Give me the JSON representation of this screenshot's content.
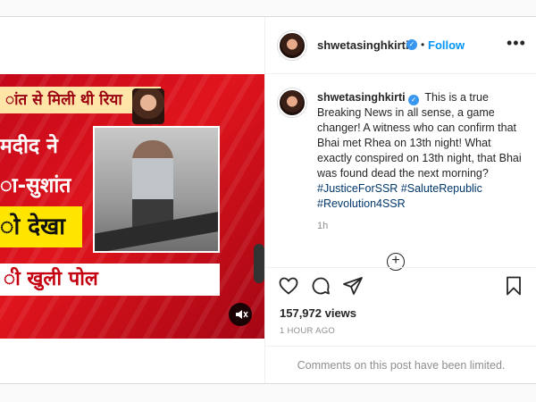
{
  "media": {
    "headline_1": "ांत से मिली थी रिया",
    "headline_2": "मदीद ने",
    "headline_3": "ा-सुशांत",
    "headline_4": "ो देखा",
    "headline_5": "ी खुली पोल",
    "mute_icon": "speaker-muted-icon"
  },
  "header": {
    "username": "shwetasinghkirti",
    "verified_icon": "verified-badge-icon",
    "separator": "•",
    "follow_label": "Follow",
    "more_icon": "ellipsis-icon"
  },
  "post": {
    "username": "shwetasinghkirti",
    "caption_text": "This is a true Breaking News in all sense, a game changer! A witness who can confirm that Bhai met Rhea on 13th night! What exactly conspired on 13th night, that Bhai was found dead the next morning?",
    "hashtag_1": "#JusticeForSSR",
    "hashtag_2": "#SaluteRepublic",
    "hashtag_3": "#Revolution4SSR",
    "time": "1h",
    "load_more_icon": "plus-circle-icon"
  },
  "actions": {
    "like_icon": "heart-icon",
    "comment_icon": "comment-icon",
    "share_icon": "paper-plane-icon",
    "save_icon": "bookmark-icon"
  },
  "stats": {
    "views": "157,972 views",
    "time_ago": "1 HOUR AGO"
  },
  "footer": {
    "comments_limited": "Comments on this post have been limited."
  }
}
